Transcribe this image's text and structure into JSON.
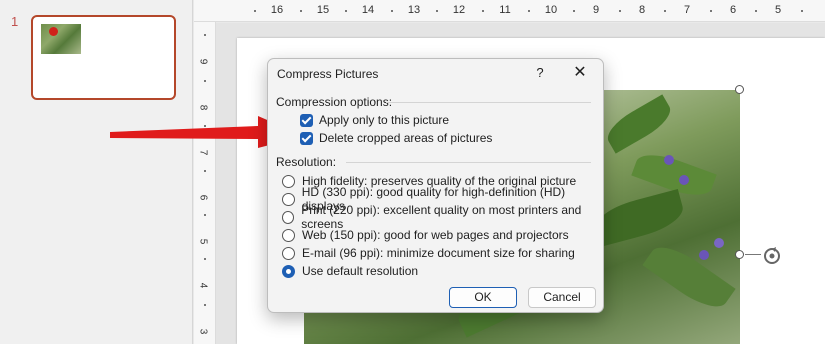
{
  "thumbnail_pane": {
    "slide_number": "1"
  },
  "ruler_top": {
    "labels": [
      "16",
      "15",
      "14",
      "13",
      "12",
      "11",
      "10",
      "9",
      "8",
      "7",
      "6",
      "5"
    ]
  },
  "ruler_left": {
    "labels": [
      "9",
      "8",
      "7",
      "6",
      "5",
      "4",
      "3"
    ]
  },
  "dialog": {
    "title": "Compress Pictures",
    "help_label": "?",
    "close_label": "✕",
    "compression_group_label": "Compression options:",
    "checkboxes": [
      {
        "label": "Apply only to this picture",
        "checked": true
      },
      {
        "label": "Delete cropped areas of pictures",
        "checked": true
      }
    ],
    "resolution_group_label": "Resolution:",
    "radios": [
      {
        "label": "High fidelity: preserves quality of the original picture",
        "selected": false
      },
      {
        "label": "HD (330 ppi): good quality for high-definition (HD) displays",
        "selected": false
      },
      {
        "label": "Print (220 ppi): excellent quality on most printers and screens",
        "selected": false
      },
      {
        "label": "Web (150 ppi): good for web pages and projectors",
        "selected": false
      },
      {
        "label": "E-mail (96 ppi): minimize document size for sharing",
        "selected": false
      },
      {
        "label": "Use default resolution",
        "selected": true
      }
    ],
    "ok_label": "OK",
    "cancel_label": "Cancel"
  },
  "colors": {
    "accent": "#1e5fb4",
    "arrow": "#e01b1b",
    "thumb_border": "#b4472a"
  },
  "icons": {
    "rotate": "rotate-handle-icon",
    "arrow": "red-arrow-annotation"
  }
}
